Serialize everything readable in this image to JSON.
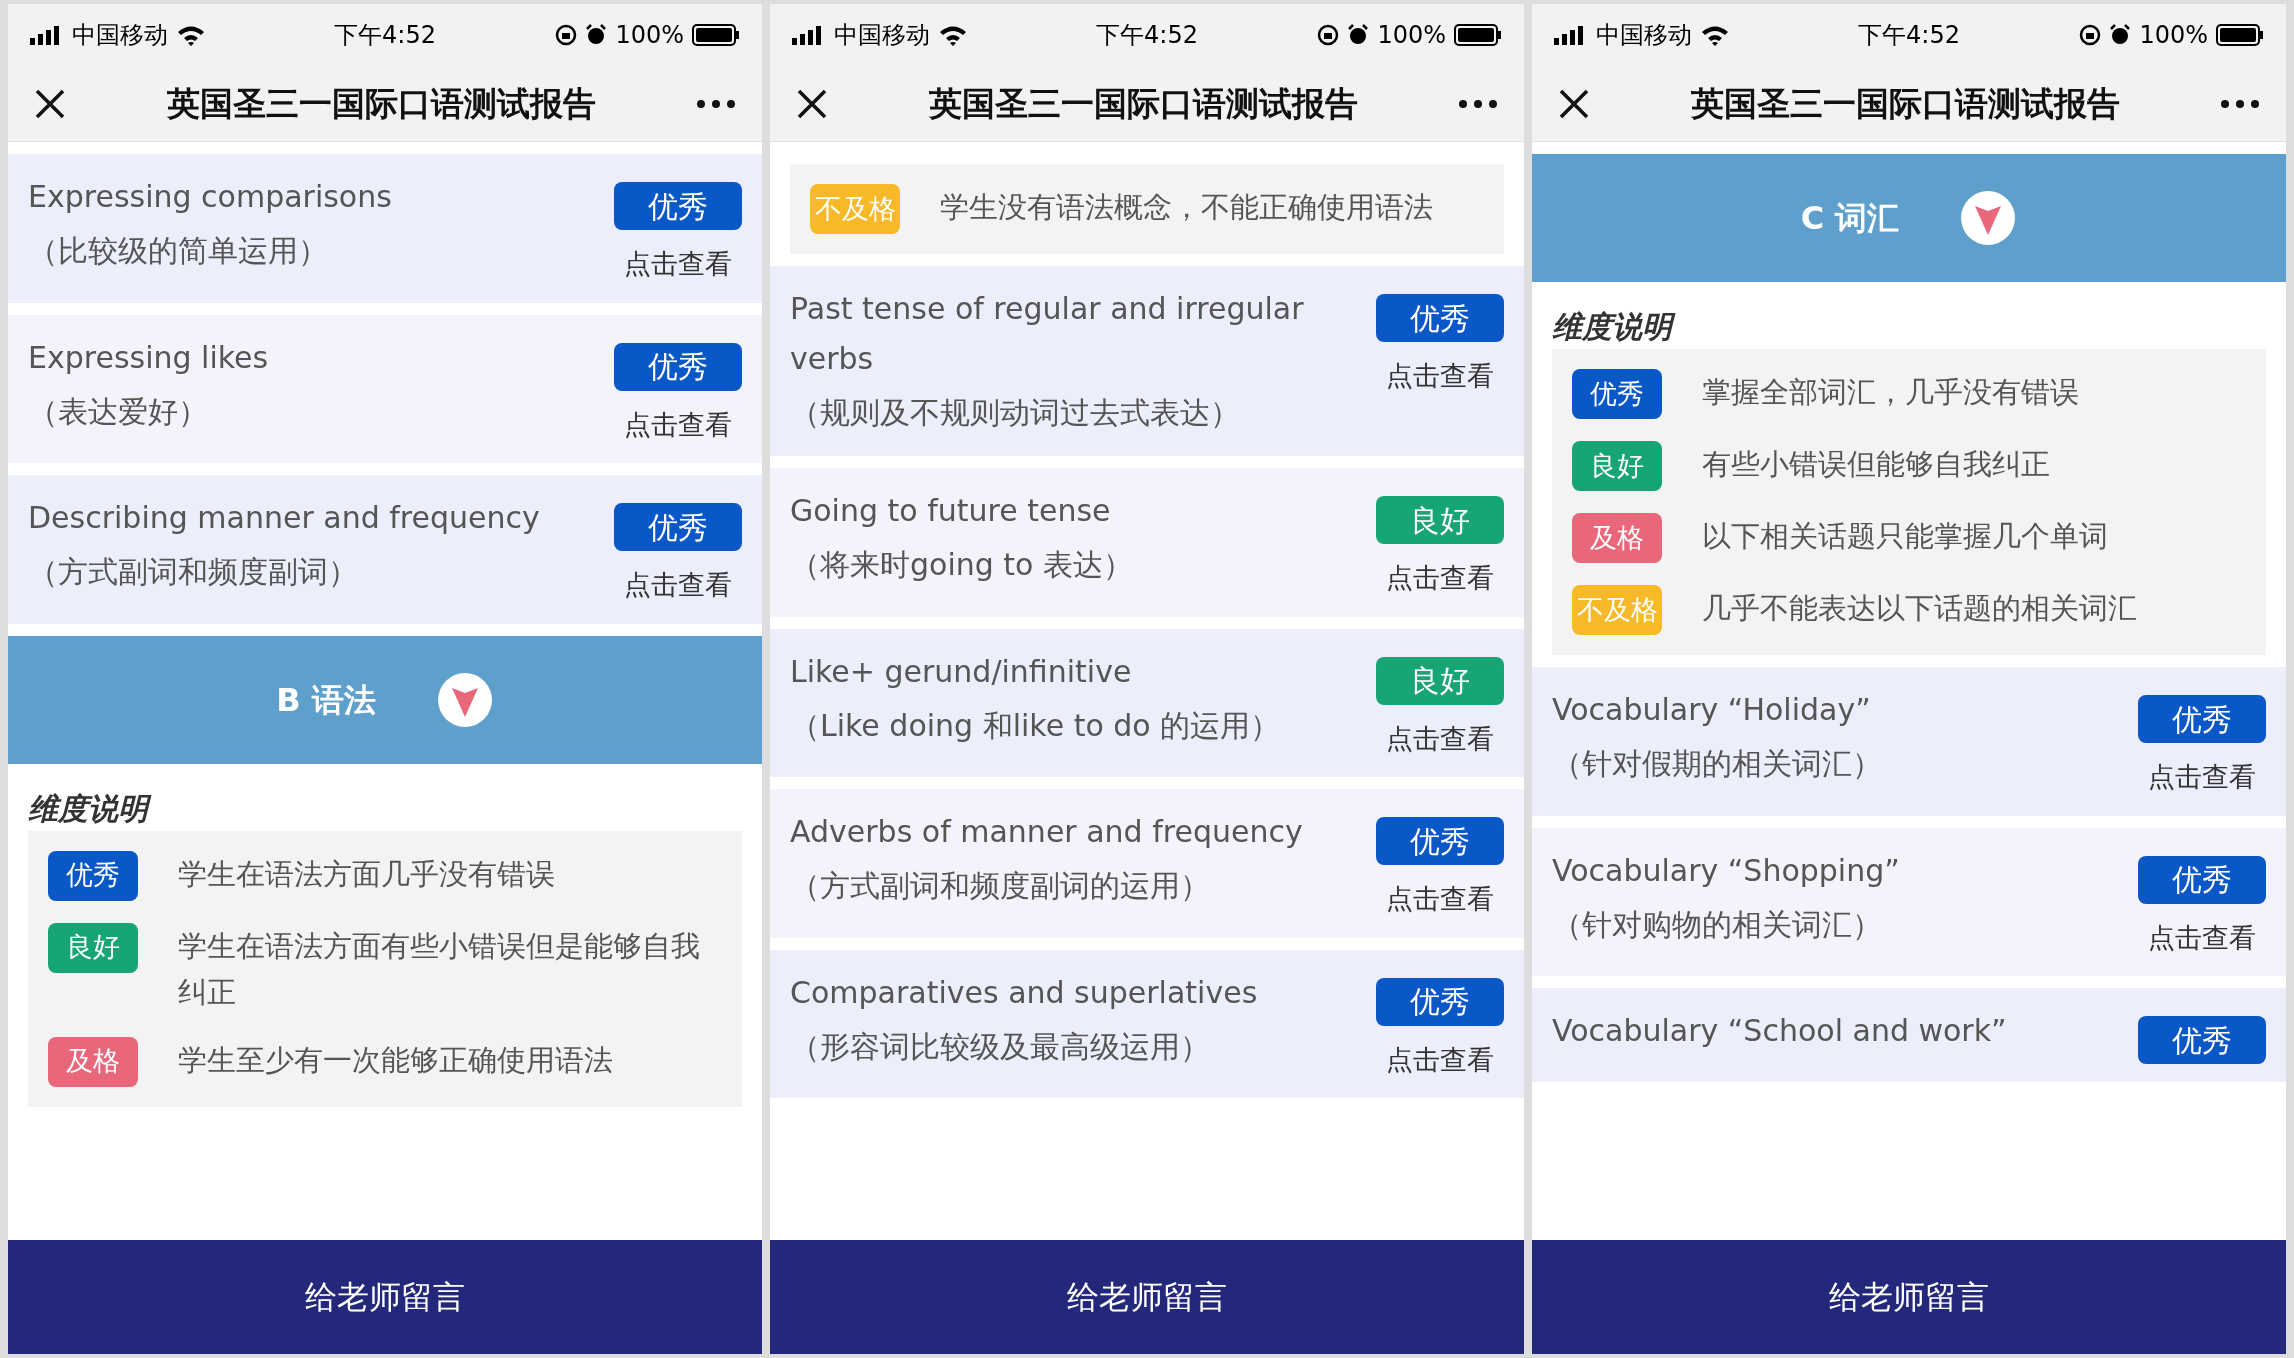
{
  "screens": [
    {
      "status_bar": {
        "carrier": "中国移动",
        "time": "下午4:52",
        "battery": "100%"
      },
      "nav": {
        "title": "英国圣三一国际口语测试报告"
      },
      "blocks": [
        {
          "kind": "item",
          "title": "Expressing comparisons",
          "subtitle": "（比较级的简单运用）",
          "grade": {
            "kind": "excellent",
            "label": "优秀"
          },
          "link": "点击查看"
        },
        {
          "kind": "item",
          "title": "Expressing likes",
          "subtitle": "（表达爱好）",
          "grade": {
            "kind": "excellent",
            "label": "优秀"
          },
          "link": "点击查看"
        },
        {
          "kind": "item",
          "title": "Describing manner and frequency",
          "subtitle": "（方式副词和频度副词）",
          "grade": {
            "kind": "excellent",
            "label": "优秀"
          },
          "link": "点击查看"
        },
        {
          "kind": "section",
          "title": "B 语法"
        },
        {
          "kind": "legend",
          "heading": "维度说明",
          "rows": [
            {
              "grade": {
                "kind": "excellent",
                "label": "优秀"
              },
              "text": "学生在语法方面几乎没有错误"
            },
            {
              "grade": {
                "kind": "good",
                "label": "良好"
              },
              "text": "学生在语法方面有些小错误但是能够自我纠正"
            },
            {
              "grade": {
                "kind": "pass",
                "label": "及格"
              },
              "text": "学生至少有一次能够正确使用语法"
            }
          ]
        }
      ],
      "footer": "给老师留言"
    },
    {
      "status_bar": {
        "carrier": "中国移动",
        "time": "下午4:52",
        "battery": "100%"
      },
      "nav": {
        "title": "英国圣三一国际口语测试报告"
      },
      "blocks": [
        {
          "kind": "legend",
          "rows": [
            {
              "grade": {
                "kind": "fail",
                "label": "不及格"
              },
              "text": "学生没有语法概念，不能正确使用语法"
            }
          ]
        },
        {
          "kind": "item",
          "title": "Past tense of regular and irregular verbs",
          "subtitle": "（规则及不规则动词过去式表达）",
          "grade": {
            "kind": "excellent",
            "label": "优秀"
          },
          "link": "点击查看"
        },
        {
          "kind": "item",
          "title": "Going to future tense",
          "subtitle": "（将来时going to 表达）",
          "grade": {
            "kind": "good",
            "label": "良好"
          },
          "link": "点击查看"
        },
        {
          "kind": "item",
          "title": "Like+ gerund/infinitive",
          "subtitle": "（Like doing 和like to do 的运用）",
          "grade": {
            "kind": "good",
            "label": "良好"
          },
          "link": "点击查看"
        },
        {
          "kind": "item",
          "title": "Adverbs of manner and frequency",
          "subtitle": "（方式副词和频度副词的运用）",
          "grade": {
            "kind": "excellent",
            "label": "优秀"
          },
          "link": "点击查看"
        },
        {
          "kind": "item",
          "title": "Comparatives and superlatives",
          "subtitle": "（形容词比较级及最高级运用）",
          "grade": {
            "kind": "excellent",
            "label": "优秀"
          },
          "link": "点击查看"
        }
      ],
      "footer": "给老师留言"
    },
    {
      "status_bar": {
        "carrier": "中国移动",
        "time": "下午4:52",
        "battery": "100%"
      },
      "nav": {
        "title": "英国圣三一国际口语测试报告"
      },
      "blocks": [
        {
          "kind": "section",
          "title": "C 词汇"
        },
        {
          "kind": "legend",
          "heading": "维度说明",
          "rows": [
            {
              "grade": {
                "kind": "excellent",
                "label": "优秀"
              },
              "text": "掌握全部词汇，几乎没有错误"
            },
            {
              "grade": {
                "kind": "good",
                "label": "良好"
              },
              "text": "有些小错误但能够自我纠正"
            },
            {
              "grade": {
                "kind": "pass",
                "label": "及格"
              },
              "text": "以下相关话题只能掌握几个单词"
            },
            {
              "grade": {
                "kind": "fail",
                "label": "不及格"
              },
              "text": "几乎不能表达以下话题的相关词汇"
            }
          ]
        },
        {
          "kind": "item",
          "title": "Vocabulary “Holiday”",
          "subtitle": "（针对假期的相关词汇）",
          "grade": {
            "kind": "excellent",
            "label": "优秀"
          },
          "link": "点击查看"
        },
        {
          "kind": "item",
          "title": "Vocabulary “Shopping”",
          "subtitle": "（针对购物的相关词汇）",
          "grade": {
            "kind": "excellent",
            "label": "优秀"
          },
          "link": "点击查看"
        },
        {
          "kind": "item",
          "title": "Vocabulary “School and work”",
          "grade": {
            "kind": "excellent",
            "label": "优秀"
          }
        }
      ],
      "footer": "给老师留言"
    }
  ]
}
